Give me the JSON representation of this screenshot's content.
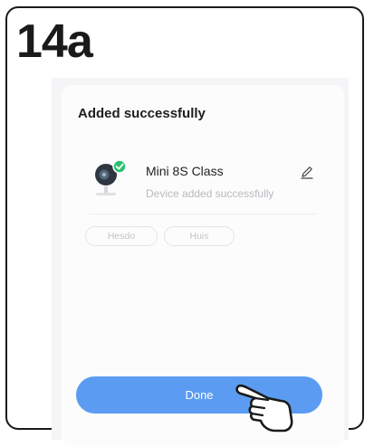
{
  "step_label": "14a",
  "dialog": {
    "title": "Added successfully",
    "device": {
      "name": "Mini 8S Class",
      "status": "Device added successfully",
      "icon": "camera-icon",
      "badge_icon": "check-icon",
      "edit_icon": "pencil-icon"
    },
    "rooms": [
      "Hesdo",
      "Huis"
    ],
    "done_label": "Done"
  },
  "colors": {
    "accent": "#5b9cf2",
    "badge": "#2fbf71"
  },
  "pointer_icon": "hand-pointer-icon"
}
